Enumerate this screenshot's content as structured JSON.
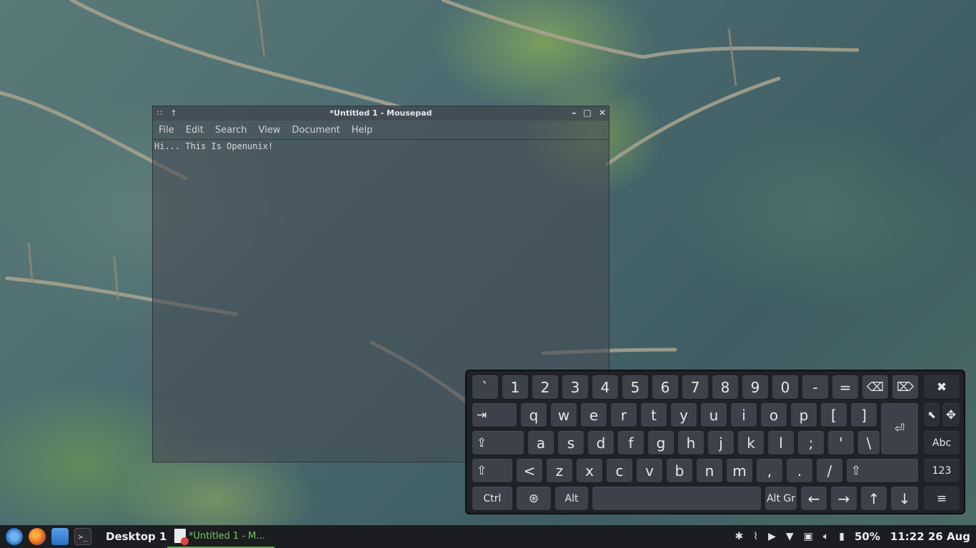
{
  "window": {
    "title": "*Untitled 1 - Mousepad",
    "menu": [
      "File",
      "Edit",
      "Search",
      "View",
      "Document",
      "Help"
    ],
    "content": "Hi... This Is Openunix!"
  },
  "keyboard": {
    "row1": [
      "`",
      "1",
      "2",
      "3",
      "4",
      "5",
      "6",
      "7",
      "8",
      "9",
      "0",
      "-",
      "="
    ],
    "row2": [
      "q",
      "w",
      "e",
      "r",
      "t",
      "y",
      "u",
      "i",
      "o",
      "p",
      "[",
      "]"
    ],
    "row3": [
      "a",
      "s",
      "d",
      "f",
      "g",
      "h",
      "j",
      "k",
      "l",
      ";",
      "'",
      "\\"
    ],
    "row4": [
      "<",
      "z",
      "x",
      "c",
      "v",
      "b",
      "n",
      "m",
      ",",
      ".",
      "/"
    ],
    "ctrl": "Ctrl",
    "alt": "Alt",
    "altgr": "Alt Gr",
    "abc": "Abc",
    "num": "123",
    "arrows": [
      "←",
      "→",
      "↑",
      "↓"
    ]
  },
  "taskbar": {
    "desktop": "Desktop 1",
    "task": "*Untitled 1 - M...",
    "battery": "50%",
    "clock": "11:22 26 Aug"
  }
}
